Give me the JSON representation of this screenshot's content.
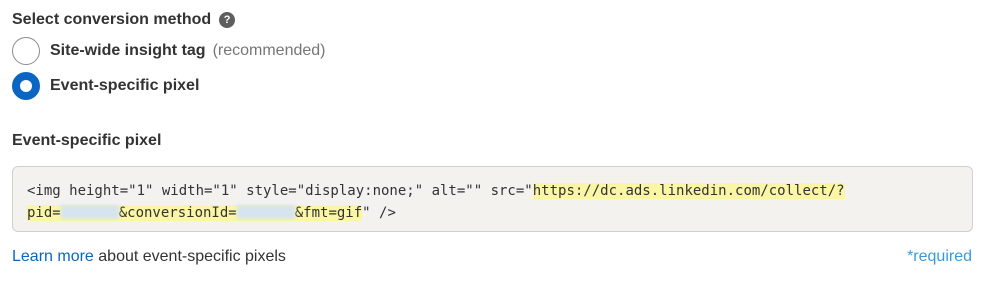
{
  "header": {
    "title": "Select conversion method",
    "help_icon": "question-circle-icon",
    "help_glyph": "?"
  },
  "options": [
    {
      "label": "Site-wide insight tag",
      "note": "(recommended)",
      "selected": false
    },
    {
      "label": "Event-specific pixel",
      "note": "",
      "selected": true
    }
  ],
  "pixel_section": {
    "title": "Event-specific pixel",
    "code_line1_plain": "<img height=\"1\" width=\"1\" style=\"display:none;\" alt=\"\" src=\"",
    "code_line1_url": "https://dc.ads.linkedin.com/collect/?",
    "code_line2_pid": "pid=",
    "code_line2_conv": "&conversionId=",
    "code_line2_fmt": "&fmt=gif",
    "code_line2_end": "\" />"
  },
  "footer": {
    "learn_more_link": "Learn more",
    "learn_more_text": " about event-specific pixels",
    "required": "*required"
  },
  "colors": {
    "accent": "#0a66c2",
    "highlight": "#fbf6a3",
    "code_bg": "#f3f2ef",
    "required": "#3a9ad9"
  }
}
